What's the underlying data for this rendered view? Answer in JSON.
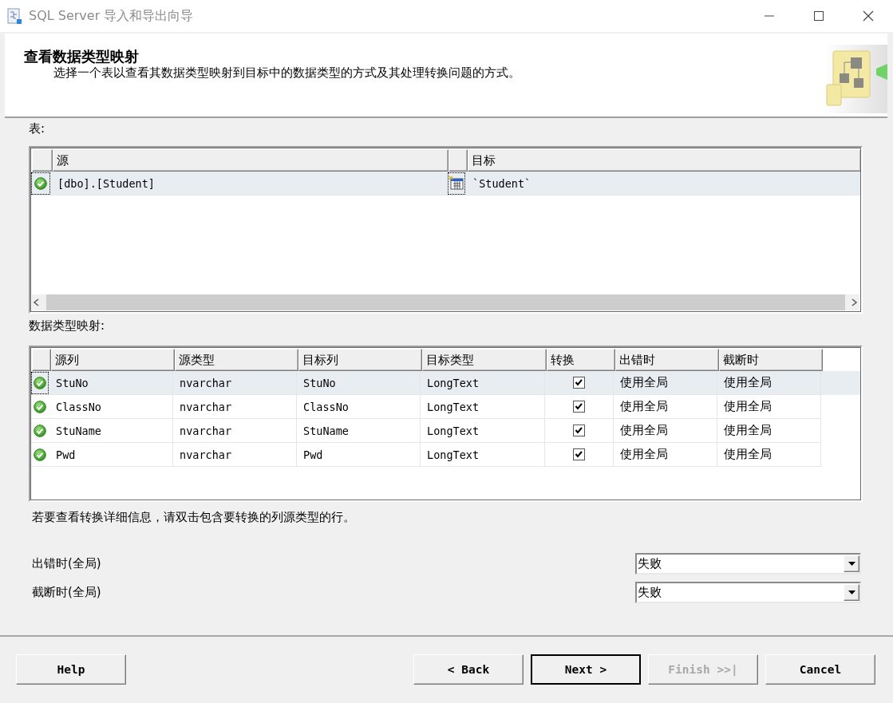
{
  "window": {
    "title": "SQL Server 导入和导出向导"
  },
  "header": {
    "title": "查看数据类型映射",
    "description": "选择一个表以查看其数据类型映射到目标中的数据类型的方式及其处理转换问题的方式。"
  },
  "tables": {
    "label": "表:",
    "columns": [
      "源",
      "目标"
    ],
    "rows": [
      {
        "source": "[dbo].[Student]",
        "target": "`Student`",
        "selected": true
      }
    ]
  },
  "mapping": {
    "label": "数据类型映射:",
    "columns": [
      "源列",
      "源类型",
      "目标列",
      "目标类型",
      "转换",
      "出错时",
      "截断时"
    ],
    "rows": [
      {
        "source_column": "StuNo",
        "source_type": "nvarchar",
        "target_column": "StuNo",
        "target_type": "LongText",
        "convert": true,
        "on_error": "使用全局",
        "on_truncation": "使用全局",
        "selected": true
      },
      {
        "source_column": "ClassNo",
        "source_type": "nvarchar",
        "target_column": "ClassNo",
        "target_type": "LongText",
        "convert": true,
        "on_error": "使用全局",
        "on_truncation": "使用全局",
        "selected": false
      },
      {
        "source_column": "StuName",
        "source_type": "nvarchar",
        "target_column": "StuName",
        "target_type": "LongText",
        "convert": true,
        "on_error": "使用全局",
        "on_truncation": "使用全局",
        "selected": false
      },
      {
        "source_column": "Pwd",
        "source_type": "nvarchar",
        "target_column": "Pwd",
        "target_type": "LongText",
        "convert": true,
        "on_error": "使用全局",
        "on_truncation": "使用全局",
        "selected": false
      }
    ]
  },
  "note": "若要查看转换详细信息，请双击包含要转换的列源类型的行。",
  "global_settings": [
    {
      "label": "出错时(全局)",
      "value": "失败"
    },
    {
      "label": "截断时(全局)",
      "value": "失败"
    }
  ],
  "buttons": [
    {
      "label": "Help",
      "default": false,
      "disabled": false
    },
    {
      "label": "< Back",
      "default": false,
      "disabled": false
    },
    {
      "label": "Next >",
      "default": true,
      "disabled": false
    },
    {
      "label": "Finish >>|",
      "default": false,
      "disabled": true
    },
    {
      "label": "Cancel",
      "default": false,
      "disabled": false
    }
  ]
}
